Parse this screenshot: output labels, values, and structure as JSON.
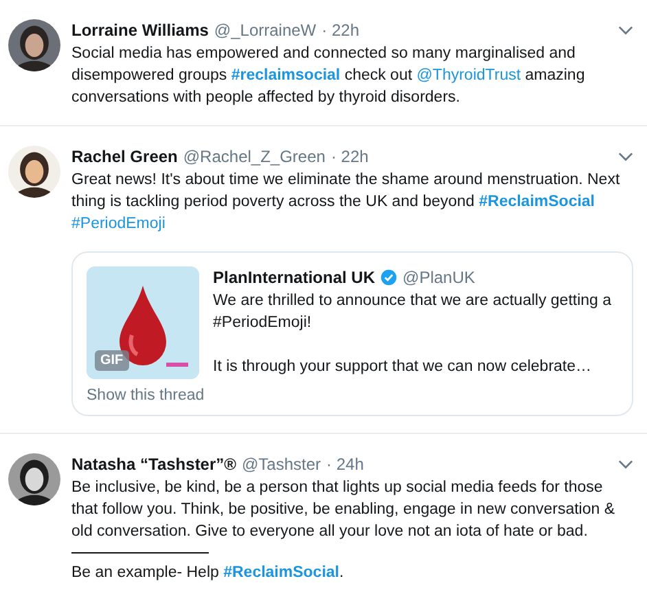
{
  "tweets": [
    {
      "name": "Lorraine Williams",
      "handle": "@_LorraineW",
      "time": "· 22h",
      "paragraphs": [
        {
          "divider_after": false,
          "parts": [
            {
              "kind": "plain",
              "text": "Social media has empowered and connected so many marginalised and disempowered groups "
            },
            {
              "kind": "link",
              "bold": true,
              "text": "#reclaimsocial"
            },
            {
              "kind": "plain",
              "text": " check out "
            },
            {
              "kind": "link",
              "bold": false,
              "text": "@ThyroidTrust"
            },
            {
              "kind": "plain",
              "text": " amazing conversations with people affected by thyroid disorders."
            }
          ]
        }
      ]
    },
    {
      "name": "Rachel Green",
      "handle": "@Rachel_Z_Green",
      "time": "· 22h",
      "paragraphs": [
        {
          "divider_after": false,
          "parts": [
            {
              "kind": "plain",
              "text": "Great news! It's about time we eliminate the shame around menstruation. Next thing is tackling period poverty across the UK and beyond "
            },
            {
              "kind": "link",
              "bold": true,
              "text": "#ReclaimSocial"
            },
            {
              "kind": "link",
              "bold": false,
              "text": "#PeriodEmoji"
            }
          ]
        }
      ],
      "quote": {
        "name": "PlanInternational UK",
        "verified": true,
        "handle": "@PlanUK",
        "text": "We are thrilled to announce that we are actually getting a #PeriodEmoji!\n\nIt is through your support that we can now celebrate…",
        "media_badge": "GIF",
        "footer": "Show this thread"
      }
    },
    {
      "name": "Natasha “Tashster”®",
      "handle": "@Tashster",
      "time": "· 24h",
      "paragraphs": [
        {
          "divider_after": true,
          "parts": [
            {
              "kind": "plain",
              "text": "Be inclusive, be kind, be a person that lights up social media feeds for those that follow you. Think, be positive, be enabling, engage in new conversation & old conversation. Give to everyone all your love not an iota of hate or bad."
            }
          ]
        },
        {
          "divider_after": false,
          "parts": [
            {
              "kind": "plain",
              "text": "Be an example- Help "
            },
            {
              "kind": "link",
              "bold": true,
              "text": "#ReclaimSocial"
            },
            {
              "kind": "plain",
              "text": "."
            }
          ]
        }
      ]
    }
  ]
}
